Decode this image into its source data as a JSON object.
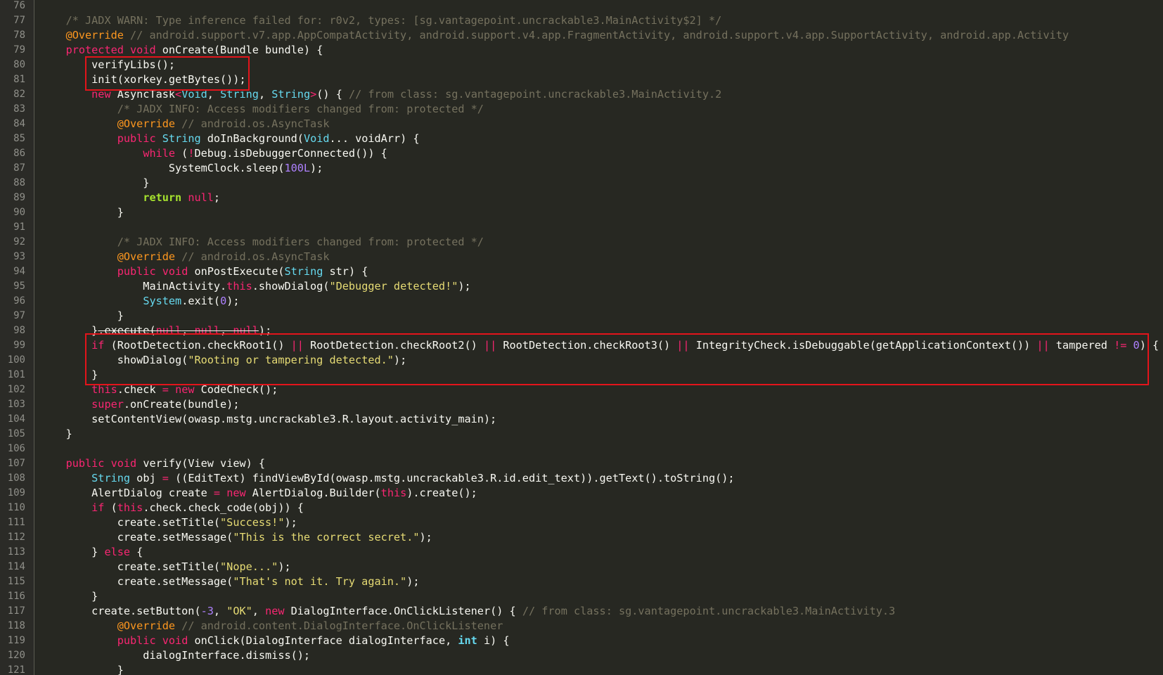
{
  "editor": {
    "lines": [
      {
        "n": "76",
        "tokens": []
      },
      {
        "n": "77",
        "tokens": [
          [
            "    ",
            "plain"
          ],
          [
            "/* JADX WARN: Type inference failed for: r0v2, types: [sg.vantagepoint.uncrackable3.MainActivity$2] */",
            "comment"
          ]
        ]
      },
      {
        "n": "78",
        "tokens": [
          [
            "    ",
            "plain"
          ],
          [
            "@Override",
            "annotation"
          ],
          [
            " // android.support.v7.app.AppCompatActivity, android.support.v4.app.FragmentActivity, android.support.v4.app.SupportActivity, android.app.Activity",
            "comment"
          ]
        ]
      },
      {
        "n": "79",
        "tokens": [
          [
            "    ",
            "plain"
          ],
          [
            "protected",
            "keyword"
          ],
          [
            " ",
            "plain"
          ],
          [
            "void",
            "keyword"
          ],
          [
            " onCreate(Bundle bundle) {",
            "plain"
          ]
        ]
      },
      {
        "n": "80",
        "tokens": [
          [
            "        verifyLibs();",
            "plain"
          ]
        ]
      },
      {
        "n": "81",
        "tokens": [
          [
            "        init(xorkey.getBytes());",
            "plain"
          ]
        ]
      },
      {
        "n": "82",
        "tokens": [
          [
            "        ",
            "plain"
          ],
          [
            "new",
            "keyword"
          ],
          [
            " AsyncTask",
            "plain"
          ],
          [
            "<",
            "keyword"
          ],
          [
            "Void",
            "type"
          ],
          [
            ", ",
            "plain"
          ],
          [
            "String",
            "type"
          ],
          [
            ", ",
            "plain"
          ],
          [
            "String",
            "type"
          ],
          [
            ">",
            "keyword"
          ],
          [
            "() { ",
            "plain"
          ],
          [
            "// from class: sg.vantagepoint.uncrackable3.MainActivity.2",
            "comment"
          ]
        ]
      },
      {
        "n": "83",
        "tokens": [
          [
            "            ",
            "plain"
          ],
          [
            "/* JADX INFO: Access modifiers changed from: protected */",
            "comment"
          ]
        ]
      },
      {
        "n": "84",
        "tokens": [
          [
            "            ",
            "plain"
          ],
          [
            "@Override",
            "annotation"
          ],
          [
            " // android.os.AsyncTask",
            "comment"
          ]
        ]
      },
      {
        "n": "85",
        "tokens": [
          [
            "            ",
            "plain"
          ],
          [
            "public",
            "keyword"
          ],
          [
            " ",
            "plain"
          ],
          [
            "String",
            "type"
          ],
          [
            " doInBackground(",
            "plain"
          ],
          [
            "Void",
            "type"
          ],
          [
            "... voidArr) {",
            "plain"
          ]
        ]
      },
      {
        "n": "86",
        "tokens": [
          [
            "                ",
            "plain"
          ],
          [
            "while",
            "keyword"
          ],
          [
            " (",
            "plain"
          ],
          [
            "!",
            "keyword"
          ],
          [
            "Debug.isDebuggerConnected()) {",
            "plain"
          ]
        ]
      },
      {
        "n": "87",
        "tokens": [
          [
            "                    SystemClock.sleep(",
            "plain"
          ],
          [
            "100L",
            "number"
          ],
          [
            ");",
            "plain"
          ]
        ]
      },
      {
        "n": "88",
        "tokens": [
          [
            "                }",
            "plain"
          ]
        ]
      },
      {
        "n": "89",
        "tokens": [
          [
            "                ",
            "plain"
          ],
          [
            "return",
            "bold"
          ],
          [
            " ",
            "plain"
          ],
          [
            "null",
            "keyword"
          ],
          [
            ";",
            "plain"
          ]
        ]
      },
      {
        "n": "90",
        "tokens": [
          [
            "            }",
            "plain"
          ]
        ]
      },
      {
        "n": "91",
        "tokens": []
      },
      {
        "n": "92",
        "tokens": [
          [
            "            ",
            "plain"
          ],
          [
            "/* JADX INFO: Access modifiers changed from: protected */",
            "comment"
          ]
        ]
      },
      {
        "n": "93",
        "tokens": [
          [
            "            ",
            "plain"
          ],
          [
            "@Override",
            "annotation"
          ],
          [
            " // android.os.AsyncTask",
            "comment"
          ]
        ]
      },
      {
        "n": "94",
        "tokens": [
          [
            "            ",
            "plain"
          ],
          [
            "public",
            "keyword"
          ],
          [
            " ",
            "plain"
          ],
          [
            "void",
            "keyword"
          ],
          [
            " onPostExecute(",
            "plain"
          ],
          [
            "String",
            "type"
          ],
          [
            " str) {",
            "plain"
          ]
        ]
      },
      {
        "n": "95",
        "tokens": [
          [
            "                MainActivity.",
            "plain"
          ],
          [
            "this",
            "keyword"
          ],
          [
            ".showDialog(",
            "plain"
          ],
          [
            "\"Debugger detected!\"",
            "string"
          ],
          [
            ");",
            "plain"
          ]
        ]
      },
      {
        "n": "96",
        "tokens": [
          [
            "                ",
            "plain"
          ],
          [
            "System",
            "type"
          ],
          [
            ".exit(",
            "plain"
          ],
          [
            "0",
            "number"
          ],
          [
            ");",
            "plain"
          ]
        ]
      },
      {
        "n": "97",
        "tokens": [
          [
            "            }",
            "plain"
          ]
        ]
      },
      {
        "n": "98",
        "tokens": [
          [
            "        }",
            "plain"
          ],
          [
            ".execute(",
            "strikeplain"
          ],
          [
            "null",
            "strike"
          ],
          [
            ", ",
            "strikeplain"
          ],
          [
            "null",
            "strike"
          ],
          [
            ", ",
            "strikeplain"
          ],
          [
            "null",
            "strike"
          ],
          [
            ");",
            "plain"
          ]
        ]
      },
      {
        "n": "99",
        "tokens": [
          [
            "        ",
            "plain"
          ],
          [
            "if",
            "keyword"
          ],
          [
            " (RootDetection.checkRoot1() ",
            "plain"
          ],
          [
            "||",
            "keyword"
          ],
          [
            " RootDetection.checkRoot2() ",
            "plain"
          ],
          [
            "||",
            "keyword"
          ],
          [
            " RootDetection.checkRoot3() ",
            "plain"
          ],
          [
            "||",
            "keyword"
          ],
          [
            " IntegrityCheck.isDebuggable(getApplicationContext()) ",
            "plain"
          ],
          [
            "||",
            "keyword"
          ],
          [
            " tampered ",
            "plain"
          ],
          [
            "!=",
            "keyword"
          ],
          [
            " ",
            "plain"
          ],
          [
            "0",
            "number"
          ],
          [
            ") {",
            "plain"
          ]
        ]
      },
      {
        "n": "100",
        "tokens": [
          [
            "            showDialog(",
            "plain"
          ],
          [
            "\"Rooting or tampering detected.\"",
            "string"
          ],
          [
            ");",
            "plain"
          ]
        ]
      },
      {
        "n": "101",
        "tokens": [
          [
            "        }",
            "plain"
          ]
        ]
      },
      {
        "n": "102",
        "tokens": [
          [
            "        ",
            "plain"
          ],
          [
            "this",
            "keyword"
          ],
          [
            ".check ",
            "plain"
          ],
          [
            "=",
            "keyword"
          ],
          [
            " ",
            "plain"
          ],
          [
            "new",
            "keyword"
          ],
          [
            " CodeCheck();",
            "plain"
          ]
        ]
      },
      {
        "n": "103",
        "tokens": [
          [
            "        ",
            "plain"
          ],
          [
            "super",
            "keyword"
          ],
          [
            ".onCreate(bundle);",
            "plain"
          ]
        ]
      },
      {
        "n": "104",
        "tokens": [
          [
            "        setContentView(owasp.mstg.uncrackable3.R.layout.activity_main);",
            "plain"
          ]
        ]
      },
      {
        "n": "105",
        "tokens": [
          [
            "    }",
            "plain"
          ]
        ]
      },
      {
        "n": "106",
        "tokens": []
      },
      {
        "n": "107",
        "tokens": [
          [
            "    ",
            "plain"
          ],
          [
            "public",
            "keyword"
          ],
          [
            " ",
            "plain"
          ],
          [
            "void",
            "keyword"
          ],
          [
            " verify(View view) {",
            "plain"
          ]
        ]
      },
      {
        "n": "108",
        "tokens": [
          [
            "        ",
            "plain"
          ],
          [
            "String",
            "type"
          ],
          [
            " obj ",
            "plain"
          ],
          [
            "=",
            "keyword"
          ],
          [
            " ((EditText) findViewById(owasp.mstg.uncrackable3.R.id.edit_text)).getText().toString();",
            "plain"
          ]
        ]
      },
      {
        "n": "109",
        "tokens": [
          [
            "        AlertDialog create ",
            "plain"
          ],
          [
            "=",
            "keyword"
          ],
          [
            " ",
            "plain"
          ],
          [
            "new",
            "keyword"
          ],
          [
            " AlertDialog.Builder(",
            "plain"
          ],
          [
            "this",
            "keyword"
          ],
          [
            ").create();",
            "plain"
          ]
        ]
      },
      {
        "n": "110",
        "tokens": [
          [
            "        ",
            "plain"
          ],
          [
            "if",
            "keyword"
          ],
          [
            " (",
            "plain"
          ],
          [
            "this",
            "keyword"
          ],
          [
            ".check.check_code(obj)) {",
            "plain"
          ]
        ]
      },
      {
        "n": "111",
        "tokens": [
          [
            "            create.setTitle(",
            "plain"
          ],
          [
            "\"Success!\"",
            "string"
          ],
          [
            ");",
            "plain"
          ]
        ]
      },
      {
        "n": "112",
        "tokens": [
          [
            "            create.setMessage(",
            "plain"
          ],
          [
            "\"This is the correct secret.\"",
            "string"
          ],
          [
            ");",
            "plain"
          ]
        ]
      },
      {
        "n": "113",
        "tokens": [
          [
            "        } ",
            "plain"
          ],
          [
            "else",
            "keyword"
          ],
          [
            " {",
            "plain"
          ]
        ]
      },
      {
        "n": "114",
        "tokens": [
          [
            "            create.setTitle(",
            "plain"
          ],
          [
            "\"Nope...\"",
            "string"
          ],
          [
            ");",
            "plain"
          ]
        ]
      },
      {
        "n": "115",
        "tokens": [
          [
            "            create.setMessage(",
            "plain"
          ],
          [
            "\"That's not it. Try again.\"",
            "string"
          ],
          [
            ");",
            "plain"
          ]
        ]
      },
      {
        "n": "116",
        "tokens": [
          [
            "        }",
            "plain"
          ]
        ]
      },
      {
        "n": "117",
        "tokens": [
          [
            "        create.setButton(",
            "plain"
          ],
          [
            "-3",
            "number"
          ],
          [
            ", ",
            "plain"
          ],
          [
            "\"OK\"",
            "string"
          ],
          [
            ", ",
            "plain"
          ],
          [
            "new",
            "keyword"
          ],
          [
            " DialogInterface.OnClickListener() { ",
            "plain"
          ],
          [
            "// from class: sg.vantagepoint.uncrackable3.MainActivity.3",
            "comment"
          ]
        ]
      },
      {
        "n": "118",
        "tokens": [
          [
            "            ",
            "plain"
          ],
          [
            "@Override",
            "annotation"
          ],
          [
            " // android.content.DialogInterface.OnClickListener",
            "comment"
          ]
        ]
      },
      {
        "n": "119",
        "tokens": [
          [
            "            ",
            "plain"
          ],
          [
            "public",
            "keyword"
          ],
          [
            " ",
            "plain"
          ],
          [
            "void",
            "keyword"
          ],
          [
            " onClick(DialogInterface dialogInterface, ",
            "plain"
          ],
          [
            "int",
            "boldtype"
          ],
          [
            " i) {",
            "plain"
          ]
        ]
      },
      {
        "n": "120",
        "tokens": [
          [
            "                dialogInterface.dismiss();",
            "plain"
          ]
        ]
      },
      {
        "n": "121",
        "tokens": [
          [
            "            }",
            "plain"
          ]
        ]
      }
    ]
  },
  "colors": {
    "background": "#272822",
    "highlight_border": "#e3141b"
  }
}
